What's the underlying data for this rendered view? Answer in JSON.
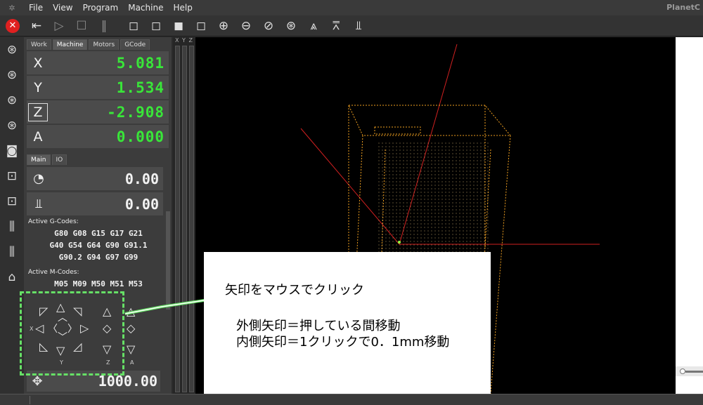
{
  "menu": {
    "logo": "✲",
    "items": [
      "File",
      "View",
      "Program",
      "Machine",
      "Help"
    ],
    "brand": "PlanetC"
  },
  "toolbar": {
    "icons": [
      "stop-icon",
      "enter-icon",
      "play-icon",
      "stop-square-icon",
      "pause-icon",
      "view-iso-icon",
      "view-top-icon",
      "view-front-icon",
      "view-side-icon",
      "zoom-in-icon",
      "zoom-out-icon",
      "zoom-fit-icon",
      "zoom-extent-icon",
      "toolpath-icon",
      "toolpath-alt-icon",
      "tool-icon"
    ]
  },
  "leftbar": {
    "icons": [
      "home-xyz-icon",
      "home-xy-icon",
      "home-z-icon",
      "home-all-icon",
      "zero-work-icon",
      "zero-xy-icon",
      "zero-z-icon",
      "tool-length-icon",
      "tool-probe-icon",
      "home-icon"
    ]
  },
  "dro": {
    "tabs": [
      "Work",
      "Machine",
      "Motors",
      "GCode"
    ],
    "active_tab": "Machine",
    "axes": [
      {
        "label": "X",
        "value": "5.081"
      },
      {
        "label": "Y",
        "value": "1.534"
      },
      {
        "label": "Z",
        "value": "-2.908"
      },
      {
        "label": "A",
        "value": "0.000"
      }
    ]
  },
  "main": {
    "tabs": [
      "Main",
      "IO"
    ],
    "speed_value": "0.00",
    "spindle_value": "0.00",
    "gcodes_title": "Active G-Codes:",
    "gcodes_lines": [
      "G80 G08 G15 G17 G21",
      "G40 G54 G64 G90 G91.1",
      "G90.2 G94 G97 G99"
    ],
    "mcodes_title": "Active M-Codes:",
    "mcodes_line": "M05 M09 M50 M51 M53"
  },
  "jog": {
    "x_label": "X",
    "y_label": "Y",
    "z_label": "Z",
    "a_label": "A",
    "feed_value": "1000.00"
  },
  "meters": {
    "header": "X Y Z"
  },
  "callout": {
    "line1": "矢印をマウスでクリック",
    "line2": "外側矢印＝押している間移動",
    "line3": "内側矢印＝1クリックで0．1mm移動"
  },
  "colors": {
    "dro_green": "#39e639",
    "annotation_green": "#66e066",
    "model_orange": "#f0a020",
    "axis_red": "#d02020"
  }
}
